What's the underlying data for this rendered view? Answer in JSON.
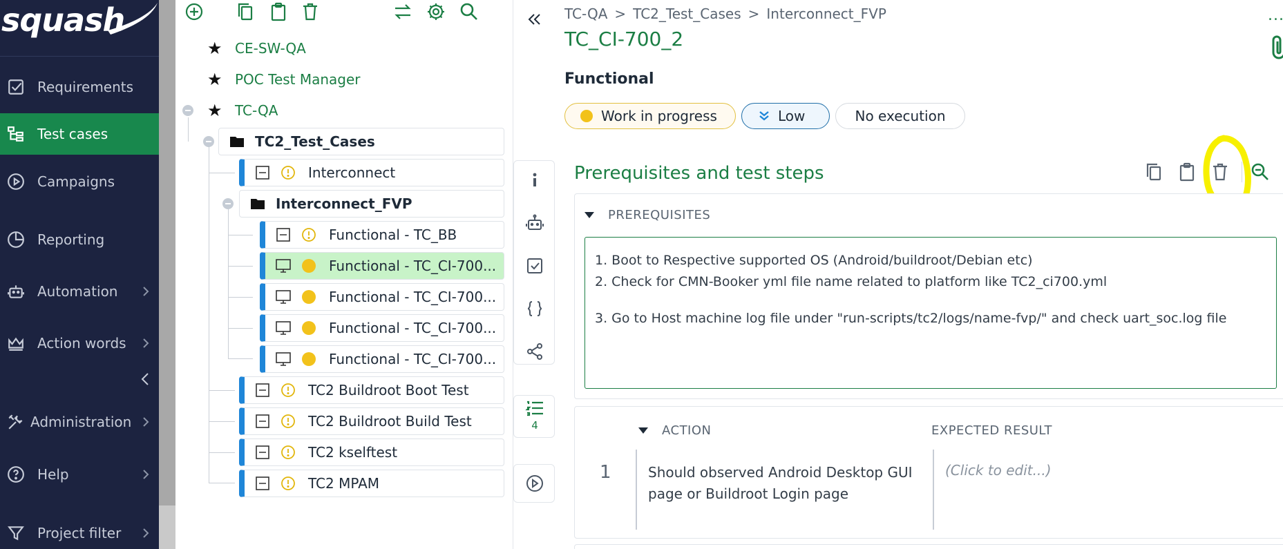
{
  "brand": {
    "logo_text": "squash"
  },
  "nav": {
    "items": [
      {
        "label": "Requirements",
        "icon": "checkbox-icon",
        "has_chevron": false
      },
      {
        "label": "Test cases",
        "icon": "tree-icon",
        "has_chevron": false,
        "active": true
      },
      {
        "label": "Campaigns",
        "icon": "play-circle-icon",
        "has_chevron": false
      },
      {
        "label": "Reporting",
        "icon": "pie-chart-icon",
        "has_chevron": false
      },
      {
        "label": "Automation",
        "icon": "robot-icon",
        "has_chevron": true
      },
      {
        "label": "Action words",
        "icon": "crown-icon",
        "has_chevron": true
      },
      {
        "label": "Administration",
        "icon": "tools-icon",
        "has_chevron": true
      },
      {
        "label": "Help",
        "icon": "help-icon",
        "has_chevron": true
      },
      {
        "label": "Project filter",
        "icon": "filter-icon",
        "has_chevron": true
      }
    ]
  },
  "tree": {
    "projects": [
      "CE-SW-QA",
      "POC Test Manager",
      "TC-QA"
    ],
    "nodes": [
      {
        "label": "TC2_Test_Cases",
        "type": "folder"
      },
      {
        "label": "Interconnect",
        "type": "test-case"
      },
      {
        "label": "Interconnect_FVP",
        "type": "folder"
      },
      {
        "label": "Functional - TC_BB",
        "type": "test-case"
      },
      {
        "label": "Functional - TC_CI-700...",
        "type": "test-case",
        "selected": true
      },
      {
        "label": "Functional - TC_CI-700...",
        "type": "test-case"
      },
      {
        "label": "Functional - TC_CI-700...",
        "type": "test-case"
      },
      {
        "label": "Functional - TC_CI-700...",
        "type": "test-case"
      },
      {
        "label": "TC2 Buildroot Boot Test",
        "type": "test-case"
      },
      {
        "label": "TC2 Buildroot Build Test",
        "type": "test-case"
      },
      {
        "label": "TC2 kselftest",
        "type": "test-case"
      },
      {
        "label": "TC2 MPAM",
        "type": "test-case"
      }
    ]
  },
  "side_tabs": {
    "steps_count": "4"
  },
  "main": {
    "breadcrumb": [
      "TC-QA",
      "TC2_Test_Cases",
      "Interconnect_FVP"
    ],
    "breadcrumb_sep": ">",
    "more": "...",
    "title": "TC_CI-700_2",
    "nature": "Functional",
    "status": "Work in progress",
    "importance": "Low",
    "execution": "No execution",
    "section_title": "Prerequisites and test steps",
    "prerequisites_label": "PREREQUISITES",
    "prerequisites": [
      "1. Boot to Respective supported OS (Android/buildroot/Debian etc)",
      "2. Check for CMN-Booker yml file name related to platform like TC2_ci700.yml",
      "3. Go to Host machine log file under \"run-scripts/tc2/logs/name-fvp/\" and check uart_soc.log file"
    ],
    "steps_header": {
      "action": "ACTION",
      "expected": "EXPECTED RESULT"
    },
    "steps": [
      {
        "number": "1",
        "action": "Should observed Android Desktop GUI page or Buildroot Login page",
        "expected": "(Click to edit...)"
      }
    ]
  },
  "colors": {
    "nav_bg": "#1c2340",
    "accent_green": "#18884d",
    "status_yellow": "#f2c21b",
    "tree_blue": "#1f86d8",
    "highlight": "#f7f000"
  }
}
